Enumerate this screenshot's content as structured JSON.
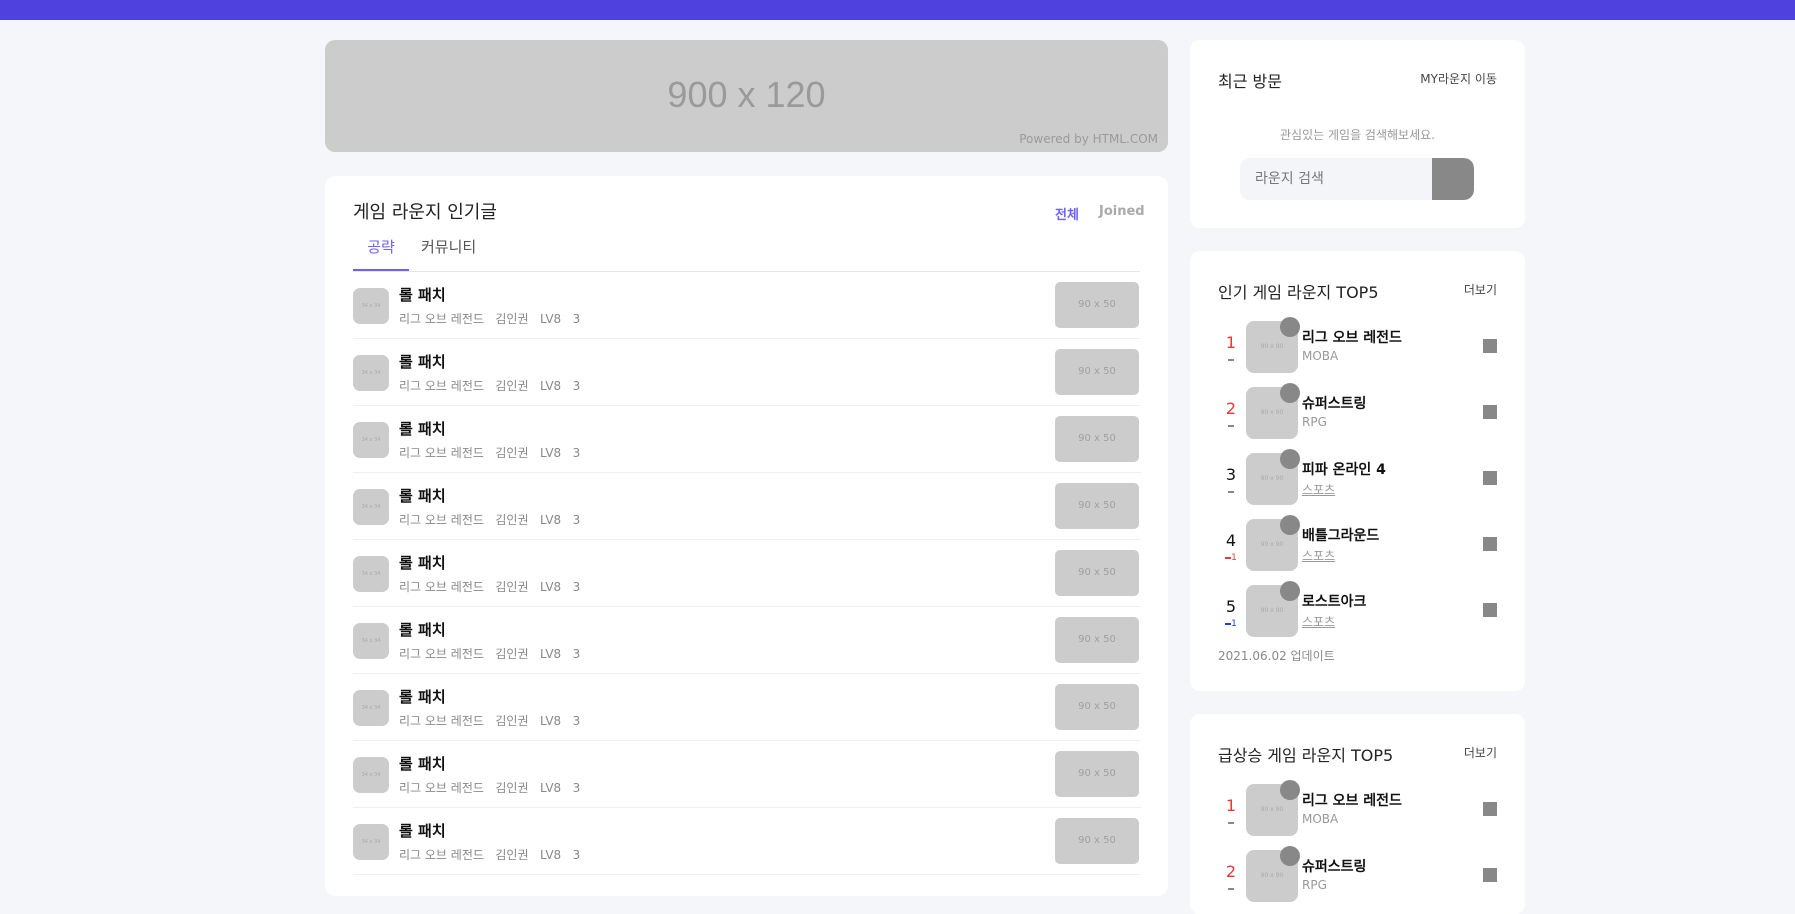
{
  "banner": {
    "size_text": "900 x 120",
    "powered": "Powered by HTML.COM"
  },
  "main": {
    "title": "게임 라운지 인기글",
    "filters": {
      "all": "전체",
      "joined": "Joined"
    },
    "tabs": [
      "공략",
      "커뮤니티"
    ],
    "posts": [
      {
        "thumb": "34 x 34",
        "title": "롤 패치",
        "game": "리그 오브 레전드",
        "author": "김인권",
        "level": "LV8",
        "count": "3",
        "image": "90 x 50"
      },
      {
        "thumb": "34 x 34",
        "title": "롤 패치",
        "game": "리그 오브 레전드",
        "author": "김인권",
        "level": "LV8",
        "count": "3",
        "image": "90 x 50"
      },
      {
        "thumb": "34 x 34",
        "title": "롤 패치",
        "game": "리그 오브 레전드",
        "author": "김인권",
        "level": "LV8",
        "count": "3",
        "image": "90 x 50"
      },
      {
        "thumb": "34 x 34",
        "title": "롤 패치",
        "game": "리그 오브 레전드",
        "author": "김인권",
        "level": "LV8",
        "count": "3",
        "image": "90 x 50"
      },
      {
        "thumb": "34 x 34",
        "title": "롤 패치",
        "game": "리그 오브 레전드",
        "author": "김인권",
        "level": "LV8",
        "count": "3",
        "image": "90 x 50"
      },
      {
        "thumb": "34 x 34",
        "title": "롤 패치",
        "game": "리그 오브 레전드",
        "author": "김인권",
        "level": "LV8",
        "count": "3",
        "image": "90 x 50"
      },
      {
        "thumb": "34 x 34",
        "title": "롤 패치",
        "game": "리그 오브 레전드",
        "author": "김인권",
        "level": "LV8",
        "count": "3",
        "image": "90 x 50"
      },
      {
        "thumb": "34 x 34",
        "title": "롤 패치",
        "game": "리그 오브 레전드",
        "author": "김인권",
        "level": "LV8",
        "count": "3",
        "image": "90 x 50"
      },
      {
        "thumb": "34 x 34",
        "title": "롤 패치",
        "game": "리그 오브 레전드",
        "author": "김인권",
        "level": "LV8",
        "count": "3",
        "image": "90 x 50"
      }
    ]
  },
  "recent": {
    "title": "최근 방문",
    "link": "MY라운지 이동",
    "hint": "관심있는 게임을 검색해보세요.",
    "search_placeholder": "라운지 검색"
  },
  "popular": {
    "title": "인기 게임 라운지 TOP5",
    "more": "더보기",
    "update": "2021.06.02 업데이트",
    "items": [
      {
        "rank": "1",
        "name": "리그 오브 레전드",
        "genre": "MOBA",
        "change": "",
        "change_color": "#888888",
        "rank_color": "#e53935"
      },
      {
        "rank": "2",
        "name": "슈퍼스트링",
        "genre": "RPG",
        "change": "",
        "change_color": "#888888",
        "rank_color": "#e53935"
      },
      {
        "rank": "3",
        "name": "피파 온라인 4",
        "genre": "스포츠",
        "change": "",
        "change_color": "#888888",
        "rank_color": "#111111"
      },
      {
        "rank": "4",
        "name": "배틀그라운드",
        "genre": "스포츠",
        "change": "1",
        "change_color": "#e53935",
        "rank_color": "#111111"
      },
      {
        "rank": "5",
        "name": "로스트아크",
        "genre": "스포츠",
        "change": "1",
        "change_color": "#1e3ddb",
        "rank_color": "#111111"
      }
    ]
  },
  "rising": {
    "title": "급상승 게임 라운지 TOP5",
    "more": "더보기",
    "items": [
      {
        "rank": "1",
        "name": "리그 오브 레전드",
        "genre": "MOBA",
        "change": "",
        "change_color": "#888888",
        "rank_color": "#e53935"
      },
      {
        "rank": "2",
        "name": "슈퍼스트링",
        "genre": "RPG",
        "change": "",
        "change_color": "#888888",
        "rank_color": "#e53935"
      }
    ]
  },
  "thumb_text": "90 x 90",
  "colors": {
    "accent": "#4f41de",
    "tab_active": "#6c63ff",
    "placeholder": "#cccccc"
  }
}
